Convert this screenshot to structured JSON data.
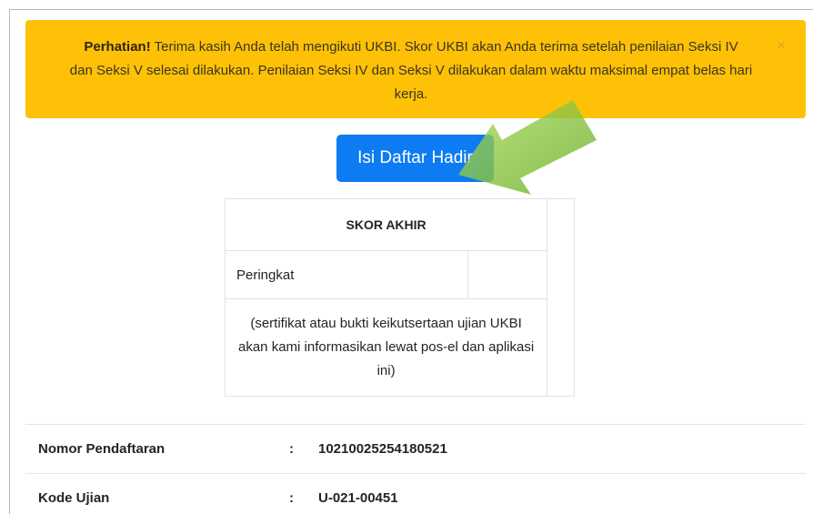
{
  "alert": {
    "bold": "Perhatian!",
    "message_line1": " Terima kasih Anda telah mengikuti UKBI. Skor UKBI akan Anda terima setelah penilaian Seksi IV",
    "message_line2": "dan Seksi V selesai dilakukan. Penilaian Seksi IV dan Seksi V dilakukan dalam waktu maksimal empat belas hari",
    "message_line3": "kerja.",
    "close": "×",
    "color": "#ffc107"
  },
  "attendance_button": {
    "label": "Isi Daftar Hadir",
    "color": "#0d7bf2"
  },
  "score_table": {
    "header": "SKOR AKHIR",
    "rank_label": "Peringkat",
    "rank_value": "",
    "note_line1": "(sertifikat atau bukti keikutsertaan ujian UKBI",
    "note_line2": "akan kami informasikan lewat pos-el dan aplikasi",
    "note_line3": "ini)"
  },
  "info": [
    {
      "label": "Nomor Pendaftaran",
      "colon": ":",
      "value": "10210025254180521"
    },
    {
      "label": "Kode Ujian",
      "colon": ":",
      "value": "U-021-00451"
    }
  ],
  "arrow_color": "#8cc63f"
}
